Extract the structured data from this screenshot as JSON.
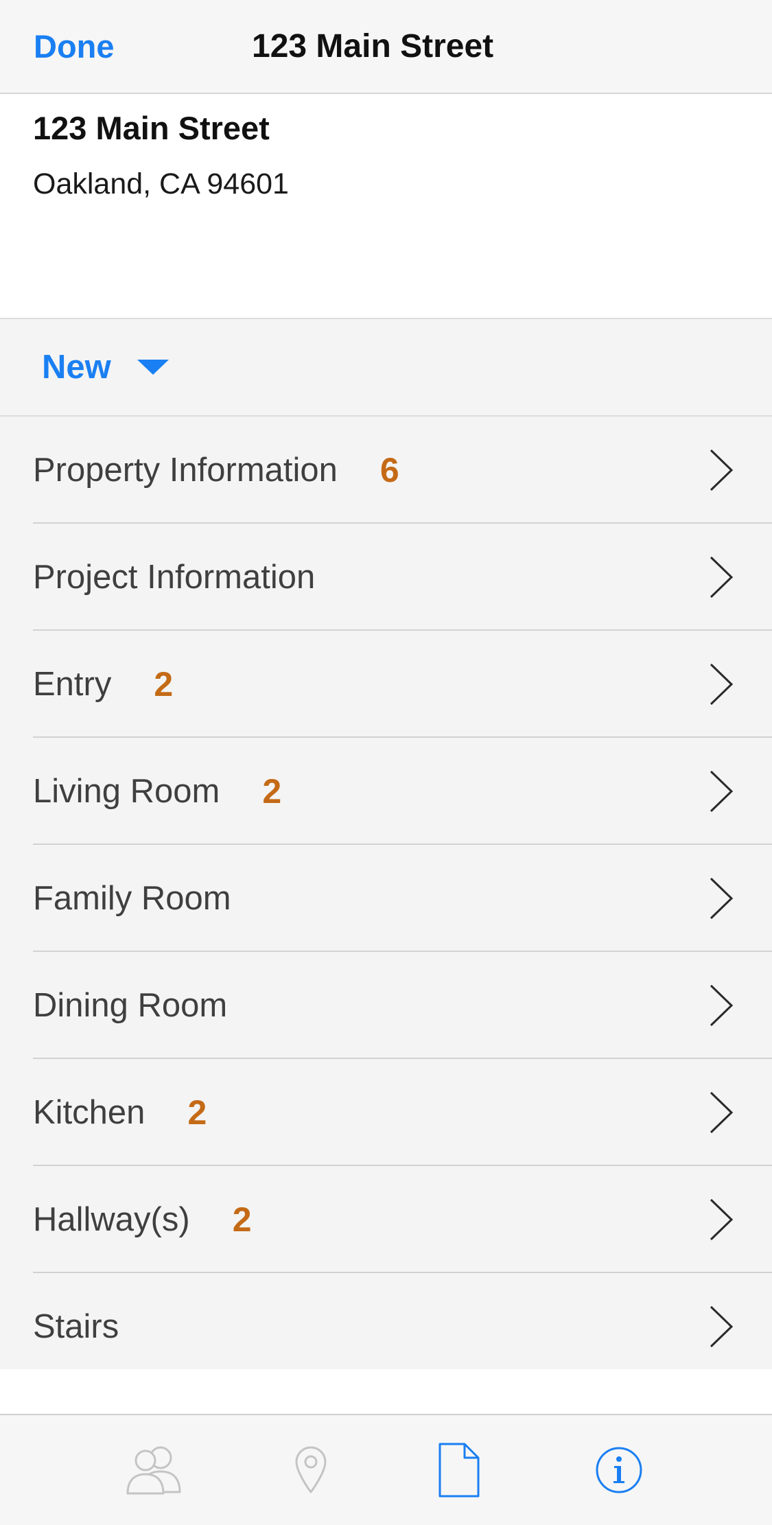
{
  "navbar": {
    "done_label": "Done",
    "title": "123 Main Street"
  },
  "address": {
    "line1": "123 Main Street",
    "line2": "Oakland, CA 94601"
  },
  "filter": {
    "label": "New"
  },
  "rows": [
    {
      "label": "Property Information",
      "count": "6"
    },
    {
      "label": "Project Information",
      "count": ""
    },
    {
      "label": "Entry",
      "count": "2"
    },
    {
      "label": "Living Room",
      "count": "2"
    },
    {
      "label": "Family Room",
      "count": ""
    },
    {
      "label": "Dining Room",
      "count": ""
    },
    {
      "label": "Kitchen",
      "count": "2"
    },
    {
      "label": "Hallway(s)",
      "count": "2"
    },
    {
      "label": "Stairs",
      "count": ""
    }
  ],
  "tabbar": {
    "items": [
      {
        "icon": "people-icon",
        "active": false
      },
      {
        "icon": "location-pin-icon",
        "active": false
      },
      {
        "icon": "document-icon",
        "active": true
      },
      {
        "icon": "info-icon",
        "active": true
      }
    ]
  },
  "colors": {
    "accent": "#1a7ff2",
    "count": "#c46a16",
    "inactive_icon": "#c4c4c4"
  }
}
